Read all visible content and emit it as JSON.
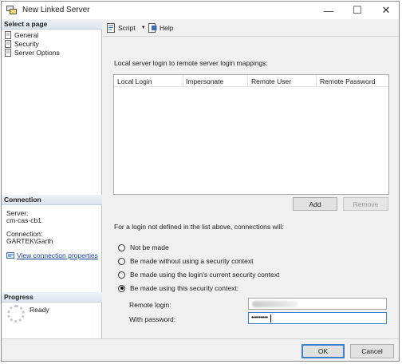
{
  "window": {
    "title": "New Linked Server",
    "minimize": "—",
    "maximize": "☐",
    "close": "✕"
  },
  "left_pane": {
    "select_page": {
      "heading": "Select a page",
      "items": [
        "General",
        "Security",
        "Server Options"
      ]
    },
    "connection": {
      "heading": "Connection",
      "server_label": "Server:",
      "server_value": "cm-cas-cb1",
      "connection_label": "Connection:",
      "connection_value": "GARTEK\\Garth",
      "view_properties_link": "View connection properties"
    },
    "progress": {
      "heading": "Progress",
      "status": "Ready"
    }
  },
  "toolbar": {
    "script_label": "Script",
    "dropdown_arrow": "▼",
    "help_label": "Help"
  },
  "mappings": {
    "caption": "Local server login to remote server login mappings:",
    "columns": [
      "Local Login",
      "Impersonate",
      "Remote User",
      "Remote Password"
    ],
    "rows": [],
    "add_button": "Add",
    "remove_button": "Remove"
  },
  "unmapped_logins": {
    "caption": "For a login not defined in the list above, connections will:",
    "options": [
      "Not be made",
      "Be made without using a security context",
      "Be made using the login's current security context",
      "Be made using this security context:"
    ],
    "selected_index": 3
  },
  "security_context": {
    "remote_login_label": "Remote login:",
    "remote_login_value": "",
    "password_label": "With password:",
    "password_value": "•••••••••"
  },
  "footer": {
    "ok_button": "OK",
    "cancel_button": "Cancel"
  },
  "icons": {
    "app": "linked-server-icon",
    "page_item": "page-icon",
    "script": "script-icon",
    "help": "help-icon",
    "connection": "connection-properties-icon",
    "progress": "progress-spinner-icon"
  },
  "colors": {
    "accent": "#3c7fd1",
    "link": "#1a3e9c",
    "section_header": "#dde4ee"
  }
}
